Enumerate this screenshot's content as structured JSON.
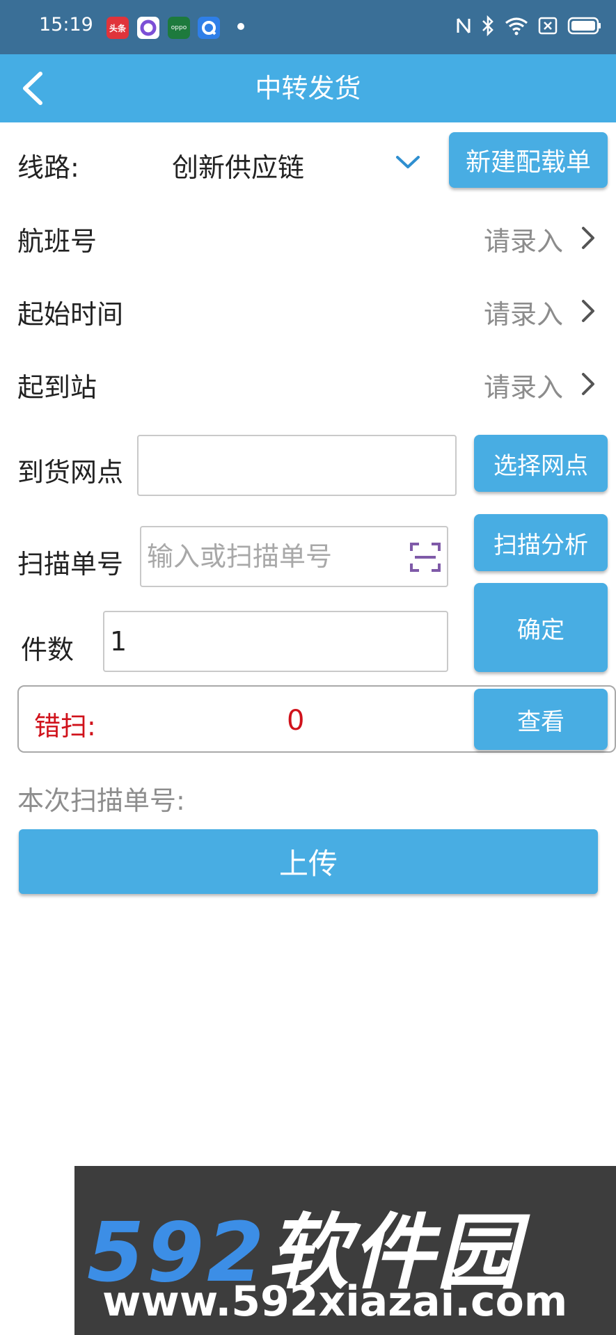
{
  "status_bar": {
    "time": "15:19",
    "notification_icons": [
      {
        "name": "toutiao-app-icon",
        "text": "头条",
        "color": "#e0343b"
      },
      {
        "name": "circle-app-icon",
        "color": "#7b4fd6"
      },
      {
        "name": "oppo-app-icon",
        "text": "oppo",
        "color": "#1d7a3d"
      },
      {
        "name": "q-app-icon",
        "color": "#2f7fe8"
      }
    ],
    "right_icons": [
      "nfc-icon",
      "bluetooth-icon",
      "wifi-icon",
      "sim-icon",
      "battery-icon"
    ]
  },
  "header": {
    "title": "中转发货",
    "back_icon": "chevron-left-icon"
  },
  "form": {
    "route": {
      "label": "线路:",
      "value": "创新供应链",
      "icon": "chevron-down-icon",
      "new_button": "新建配载单"
    },
    "flight": {
      "label": "航班号",
      "placeholder": "请录入"
    },
    "start_time": {
      "label": "起始时间",
      "placeholder": "请录入"
    },
    "stations": {
      "label": "起到站",
      "placeholder": "请录入"
    },
    "arrival_point": {
      "label": "到货网点",
      "value": "",
      "button": "选择网点"
    },
    "scan_number": {
      "label": "扫描单号",
      "placeholder": "输入或扫描单号",
      "scan_icon": "scan-frame-icon",
      "button": "扫描分析"
    },
    "quantity": {
      "label": "件数",
      "value": "1",
      "button": "确定"
    },
    "mis_scan": {
      "label": "错扫:",
      "count": "0",
      "button": "查看"
    },
    "scanned_label": "本次扫描单号:",
    "upload_button": "上传"
  },
  "watermark": {
    "brand_number": "592",
    "brand_text": "软件园",
    "url": "www.592xiazai.com"
  },
  "colors": {
    "status_bar": "#3a6f97",
    "app_bar": "#45ade4",
    "button": "#48ade3",
    "error_text": "#d0121b",
    "watermark_bg": "#3d3d3d"
  }
}
